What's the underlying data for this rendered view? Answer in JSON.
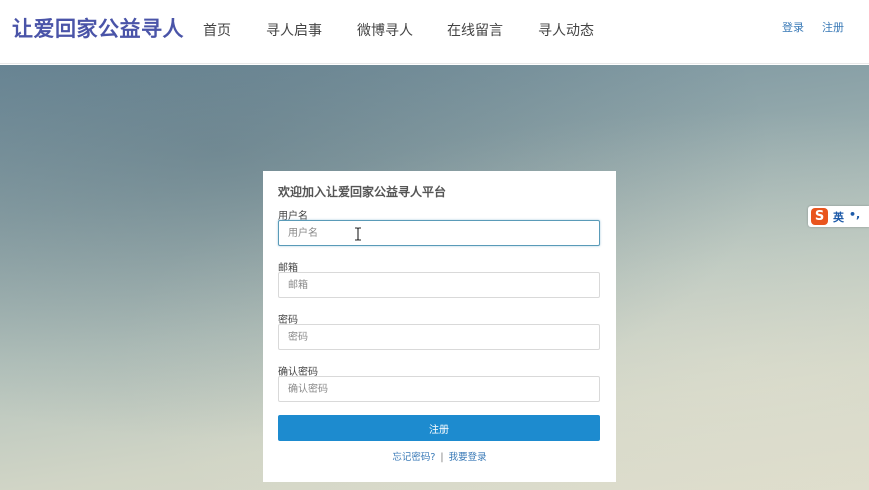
{
  "brand": {
    "title": "让爱回家公益寻人"
  },
  "nav": {
    "items": [
      {
        "label": "首页"
      },
      {
        "label": "寻人启事"
      },
      {
        "label": "微博寻人"
      },
      {
        "label": "在线留言"
      },
      {
        "label": "寻人动态"
      }
    ],
    "login_label": "登录",
    "register_label": "注册"
  },
  "form": {
    "title": "欢迎加入让爱回家公益寻人平台",
    "fields": [
      {
        "label": "用户名",
        "placeholder": "用户名",
        "value": ""
      },
      {
        "label": "邮箱",
        "placeholder": "邮箱",
        "value": ""
      },
      {
        "label": "密码",
        "placeholder": "密码",
        "value": ""
      },
      {
        "label": "确认密码",
        "placeholder": "确认密码",
        "value": ""
      }
    ],
    "submit_label": "注册",
    "forgot_password_label": "忘记密码?",
    "separator": "|",
    "login_link_label": "我要登录"
  },
  "ime": {
    "logo": "S",
    "lang": "英",
    "punct": "•,"
  },
  "colors": {
    "brand": "#4a54a8",
    "link": "#3a7ab7",
    "button": "#1d8bcf",
    "ime_logo": "#e9551e"
  },
  "icons": {
    "cursor": "text-cursor-icon",
    "ime": "sogou-ime-icon"
  }
}
